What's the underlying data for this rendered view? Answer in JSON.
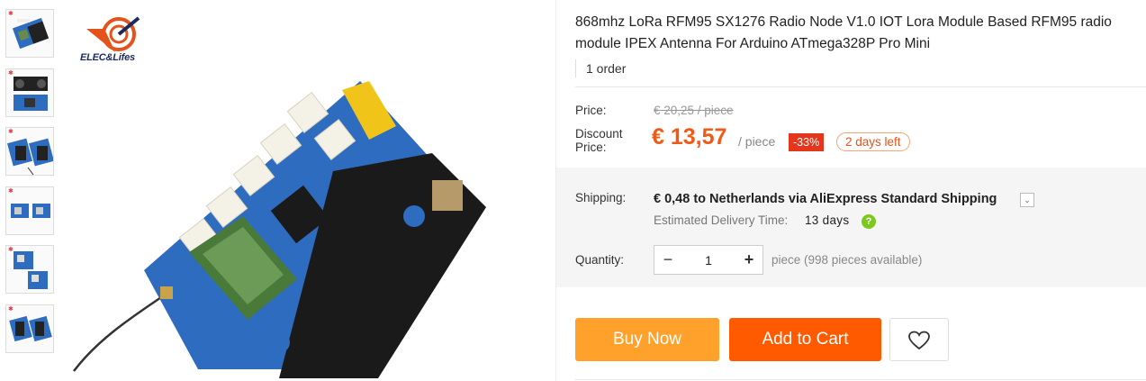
{
  "brand": {
    "name": "ELEC&Lifes"
  },
  "product": {
    "title": "868mhz LoRa RFM95 SX1276 Radio Node V1.0 IOT Lora Module Based RFM95 radio module IPEX Antenna For Arduino ATmega328P Pro Mini",
    "orders": "1 order"
  },
  "price": {
    "label": "Price:",
    "original": "€ 20,25 / piece",
    "discount_label": "Discount Price:",
    "current": "€ 13,57",
    "unit": "/ piece",
    "discount_percent": "-33%",
    "time_left": "2 days left"
  },
  "shipping": {
    "label": "Shipping:",
    "value": "€ 0,48 to Netherlands via AliExpress Standard Shipping",
    "estimated_label": "Estimated Delivery Time:",
    "estimated_value": "13 days",
    "help_symbol": "?",
    "caret_symbol": "⌄"
  },
  "quantity": {
    "label": "Quantity:",
    "value": "1",
    "minus_symbol": "−",
    "plus_symbol": "+",
    "available": "piece (998 pieces available)"
  },
  "actions": {
    "buy_now": "Buy Now",
    "add_to_cart": "Add to Cart"
  },
  "thumbnails": [
    {
      "name": "thumbnail-1"
    },
    {
      "name": "thumbnail-2"
    },
    {
      "name": "thumbnail-3"
    },
    {
      "name": "thumbnail-4"
    },
    {
      "name": "thumbnail-5"
    },
    {
      "name": "thumbnail-6"
    }
  ],
  "icons": {
    "wishlist": "heart-icon",
    "help": "help-icon",
    "dropdown": "chevron-down-icon"
  },
  "colors": {
    "price_orange": "#f05a14",
    "buy_now": "#ffa12a",
    "add_to_cart": "#ff5a00",
    "discount_badge": "#e4361c",
    "help_green": "#7cc81c"
  }
}
